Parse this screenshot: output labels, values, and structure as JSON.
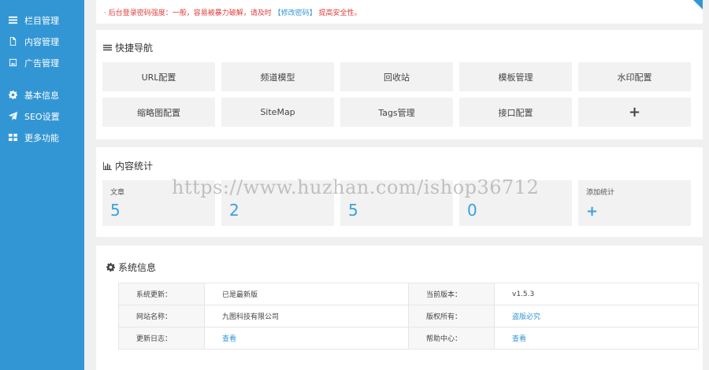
{
  "sidebar": {
    "items": [
      {
        "label": "栏目管理",
        "icon": "list-icon"
      },
      {
        "label": "内容管理",
        "icon": "file-icon"
      },
      {
        "label": "广告管理",
        "icon": "image-icon"
      },
      {
        "label": "基本信息",
        "icon": "gear-icon"
      },
      {
        "label": "SEO设置",
        "icon": "paper-plane-icon"
      },
      {
        "label": "更多功能",
        "icon": "grid-icon"
      }
    ],
    "bg_color": "#3396d4"
  },
  "notice": {
    "prefix": "· 后台登录密码强度：一般，容易被暴力破解，请及时",
    "link": "【修改密码】",
    "suffix": "提高安全性。"
  },
  "quick": {
    "title": "快捷导航",
    "buttons": [
      "URL配置",
      "频道模型",
      "回收站",
      "模板管理",
      "水印配置",
      "缩略图配置",
      "SiteMap",
      "Tags管理",
      "接口配置",
      "+"
    ]
  },
  "stats": {
    "title": "内容统计",
    "cards": [
      {
        "label": "文章",
        "value": "5"
      },
      {
        "label": "",
        "value": "2"
      },
      {
        "label": "",
        "value": "5"
      },
      {
        "label": "",
        "value": "0"
      }
    ],
    "add_label": "添加统计",
    "add_symbol": "+"
  },
  "watermark": "https://www.huzhan.com/ishop36712",
  "system": {
    "title": "系统信息",
    "rows": [
      {
        "k1": "系统更新：",
        "v1": "已是最新版",
        "k2": "当前版本：",
        "v2": "v1.5.3"
      },
      {
        "k1": "网站名称：",
        "v1": "九图科技有限公司",
        "k2": "版权所有：",
        "v2": "盗版必究"
      },
      {
        "k1": "更新日志：",
        "v1": "查看",
        "k2": "帮助中心：",
        "v2": "查看"
      }
    ]
  },
  "colors": {
    "accent": "#3396d4",
    "stat_value": "#3aa0dd",
    "notice_red": "#e03b3b"
  }
}
